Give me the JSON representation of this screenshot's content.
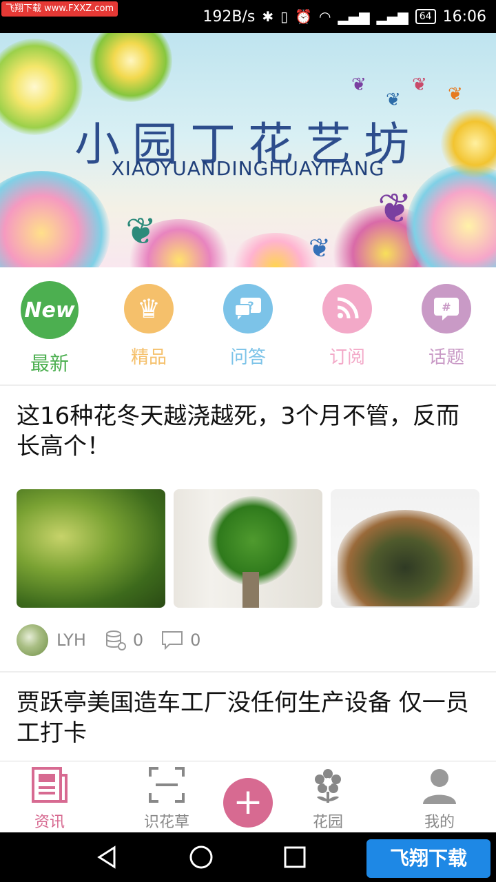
{
  "status_bar": {
    "watermark": "飞翔下载 www.FXXZ.com",
    "net_speed": "192B/s",
    "battery": "64",
    "time": "16:06"
  },
  "banner": {
    "title": "小园丁花艺坊",
    "subtitle": "XIAOYUANDINGHUAYIFANG"
  },
  "categories": [
    {
      "label": "最新",
      "icon": "new-badge-icon",
      "badge_text": "New",
      "color": "#4caf50"
    },
    {
      "label": "精品",
      "icon": "crown-icon",
      "color": "#f5c06b"
    },
    {
      "label": "问答",
      "icon": "question-chat-icon",
      "color": "#7cc3e8"
    },
    {
      "label": "订阅",
      "icon": "rss-icon",
      "color": "#f3a9c8"
    },
    {
      "label": "话题",
      "icon": "topic-hash-icon",
      "color": "#c99ac6"
    }
  ],
  "articles": [
    {
      "title": "这16种花冬天越浇越死，3个月不管，反而长高个！",
      "author": "LYH",
      "favorites": "0",
      "comments": "0"
    },
    {
      "title": "贾跃亭美国造车工厂没任何生产设备 仅一员工打卡"
    }
  ],
  "tabs": [
    {
      "label": "资讯",
      "icon": "news-icon",
      "active": true
    },
    {
      "label": "识花草",
      "icon": "scan-icon"
    },
    {
      "label": "",
      "icon": "add-icon"
    },
    {
      "label": "花园",
      "icon": "flower-icon"
    },
    {
      "label": "我的",
      "icon": "person-icon"
    }
  ],
  "nav_watermark": "飞翔下载",
  "colors": {
    "accent": "#d76a91",
    "inactive": "#888888"
  }
}
